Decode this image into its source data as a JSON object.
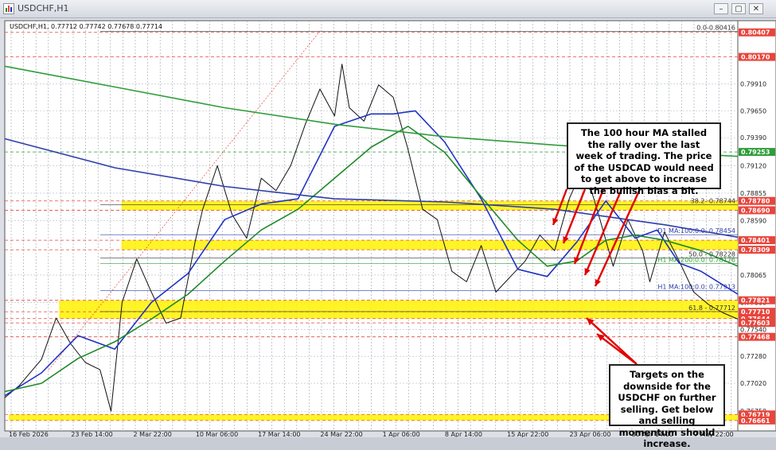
{
  "window": {
    "title": "USDCHF,H1",
    "buttons": {
      "minimize": "–",
      "restore": "▢",
      "close": "✕"
    }
  },
  "chart_data": {
    "type": "line",
    "symbol": "USDCHF,H1",
    "ohlc_label": "0.77712 0.77742 0.77678 0.77714",
    "ylim": [
      0.7656,
      0.8052
    ],
    "x_tick_labels": [
      "16 Feb 2026",
      "23 Feb 14:00",
      "2 Mar 22:00",
      "10 Mar 06:00",
      "17 Mar 14:00",
      "24 Mar 22:00",
      "1 Apr 06:00",
      "8 Apr 14:00",
      "15 Apr 22:00",
      "23 Apr 06:00",
      "30 Apr 14:00",
      "7 May 22:00"
    ],
    "y_tick_labels": [
      0.78065,
      0.778,
      0.7754,
      0.7728,
      0.7702,
      0.7675,
      0.7965,
      0.7939,
      0.7912,
      0.78855,
      0.7859,
      0.7991
    ],
    "price_tags": [
      {
        "text": "0.80407",
        "value": 0.80407,
        "color": "#e8453c"
      },
      {
        "text": "0.80170",
        "value": 0.8017,
        "color": "#e8453c"
      },
      {
        "text": "0.79253",
        "value": 0.79253,
        "color": "#2f9d3a"
      },
      {
        "text": "0.78780",
        "value": 0.7878,
        "color": "#e8453c"
      },
      {
        "text": "0.78690",
        "value": 0.7869,
        "color": "#e8453c"
      },
      {
        "text": "0.78401",
        "value": 0.78401,
        "color": "#e8453c"
      },
      {
        "text": "0.78309",
        "value": 0.78309,
        "color": "#e8453c"
      },
      {
        "text": "0.77821",
        "value": 0.77821,
        "color": "#e8453c"
      },
      {
        "text": "0.77710",
        "value": 0.7771,
        "color": "#e8453c"
      },
      {
        "text": "0.77644",
        "value": 0.77644,
        "color": "#e8453c"
      },
      {
        "text": "0.77603",
        "value": 0.77603,
        "color": "#e8453c"
      },
      {
        "text": "0.77468",
        "value": 0.77468,
        "color": "#e8453c"
      },
      {
        "text": "0.76719",
        "value": 0.76719,
        "color": "#e8453c"
      },
      {
        "text": "0.76661",
        "value": 0.76661,
        "color": "#e8453c"
      }
    ],
    "zones": [
      {
        "from": 0.7869,
        "to": 0.7878,
        "x_start_label": "2 Mar 22:00"
      },
      {
        "from": 0.78309,
        "to": 0.78401,
        "x_start_label": "2 Mar 22:00"
      },
      {
        "from": 0.77644,
        "to": 0.77821,
        "x_start_label": "23 Feb 14:00"
      },
      {
        "from": 0.76661,
        "to": 0.76719,
        "x_start_label": "16 Feb 2026"
      }
    ],
    "level_labels": [
      {
        "text": "0.0-0.80416",
        "value": 0.80416,
        "color": "#333"
      },
      {
        "text": "38.2- 0.78744",
        "value": 0.78744,
        "color": "#333"
      },
      {
        "text": "D1 MA:100:0.0: 0.78454",
        "value": 0.78454,
        "color": "#2d3eaa"
      },
      {
        "text": "50.0 - 0.78228",
        "value": 0.78228,
        "color": "#333"
      },
      {
        "text": "H1 MA:200:0.0: 0.78176",
        "value": 0.78176,
        "color": "#2f9d3a"
      },
      {
        "text": "H1 MA:100:0.0: 0.77913",
        "value": 0.77913,
        "color": "#2d3eaa"
      },
      {
        "text": "61.8 - 0.77712",
        "value": 0.77712,
        "color": "#333"
      }
    ],
    "series": [
      {
        "name": "",
        "color": "#111",
        "x": [
          0,
          0.02,
          0.05,
          0.07,
          0.09,
          0.11,
          0.13,
          0.145,
          0.16,
          0.18,
          0.2,
          0.22,
          0.24,
          0.26,
          0.27,
          0.29,
          0.31,
          0.33,
          0.35,
          0.37,
          0.39,
          0.41,
          0.43,
          0.45,
          0.46,
          0.47,
          0.49,
          0.51,
          0.53,
          0.55,
          0.57,
          0.59,
          0.61,
          0.63,
          0.65,
          0.67,
          0.69,
          0.71,
          0.73,
          0.75,
          0.77,
          0.79,
          0.81,
          0.83,
          0.85,
          0.87,
          0.88,
          0.9,
          0.92,
          0.94,
          0.96,
          0.98,
          1.0
        ],
        "y": [
          0.7688,
          0.77,
          0.7725,
          0.7765,
          0.774,
          0.7722,
          0.7715,
          0.7675,
          0.778,
          0.7822,
          0.779,
          0.776,
          0.7765,
          0.784,
          0.787,
          0.7912,
          0.7865,
          0.7842,
          0.79,
          0.7888,
          0.7912,
          0.7952,
          0.7986,
          0.796,
          0.801,
          0.7968,
          0.7955,
          0.799,
          0.7978,
          0.7928,
          0.787,
          0.786,
          0.781,
          0.78,
          0.7835,
          0.779,
          0.7805,
          0.782,
          0.7845,
          0.783,
          0.788,
          0.7912,
          0.7865,
          0.7815,
          0.786,
          0.783,
          0.78,
          0.7848,
          0.782,
          0.779,
          0.7778,
          0.777,
          0.7764
        ]
      },
      {
        "name": "",
        "color": "#1f33c4",
        "x": [
          0,
          0.05,
          0.1,
          0.15,
          0.2,
          0.25,
          0.3,
          0.35,
          0.4,
          0.45,
          0.5,
          0.53,
          0.56,
          0.6,
          0.65,
          0.7,
          0.74,
          0.78,
          0.82,
          0.86,
          0.89,
          0.92,
          0.95,
          1.0
        ],
        "y": [
          0.769,
          0.7712,
          0.7748,
          0.7735,
          0.778,
          0.7808,
          0.786,
          0.7875,
          0.788,
          0.795,
          0.7962,
          0.7962,
          0.7965,
          0.7935,
          0.788,
          0.7812,
          0.7805,
          0.7838,
          0.7878,
          0.7842,
          0.785,
          0.7818,
          0.781,
          0.7788
        ]
      },
      {
        "name": "",
        "color": "#1f8a2a",
        "x": [
          0,
          0.05,
          0.1,
          0.15,
          0.2,
          0.25,
          0.3,
          0.35,
          0.4,
          0.45,
          0.5,
          0.55,
          0.6,
          0.65,
          0.7,
          0.74,
          0.78,
          0.82,
          0.86,
          0.9,
          0.95,
          1.0
        ],
        "y": [
          0.7694,
          0.7702,
          0.7726,
          0.7742,
          0.7764,
          0.7788,
          0.782,
          0.785,
          0.787,
          0.79,
          0.793,
          0.795,
          0.7925,
          0.7882,
          0.784,
          0.7815,
          0.782,
          0.784,
          0.7845,
          0.784,
          0.783,
          0.7815
        ]
      },
      {
        "name": "",
        "color": "#2d3eaa",
        "x": [
          0,
          0.15,
          0.3,
          0.45,
          0.6,
          0.75,
          0.9,
          1.0
        ],
        "y": [
          0.7938,
          0.791,
          0.7892,
          0.788,
          0.7877,
          0.787,
          0.7855,
          0.7843
        ]
      },
      {
        "name": "",
        "color": "#2f9d3a",
        "x": [
          0,
          0.15,
          0.3,
          0.45,
          0.6,
          0.75,
          0.9,
          1.0
        ],
        "y": [
          0.8008,
          0.7988,
          0.7968,
          0.7952,
          0.794,
          0.7932,
          0.7925,
          0.7921
        ]
      }
    ]
  },
  "callouts": {
    "top": "The 100 hour MA stalled the rally over the last week of trading. The price of the USDCAD would need to get above to increase the bullish bias a bit.",
    "bottom": "Targets on the downside for the USDCHF on further selling. Get below and selling momentum should increase."
  }
}
